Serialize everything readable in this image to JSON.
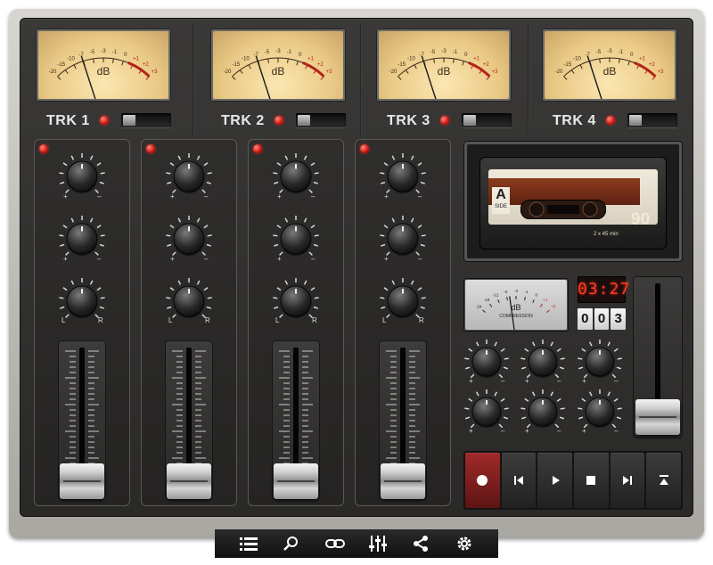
{
  "meters": [
    {
      "track_label": "TRK 1"
    },
    {
      "track_label": "TRK 2"
    },
    {
      "track_label": "TRK 3"
    },
    {
      "track_label": "TRK 4"
    }
  ],
  "meter_scale": {
    "unit": "dB",
    "ticks": [
      "-20",
      "-15",
      "-10",
      "-7",
      "-5",
      "-3",
      "-1",
      "0",
      "+1",
      "+2",
      "+3"
    ]
  },
  "pan_labels": {
    "left": "L",
    "right": "R"
  },
  "cassette": {
    "side": "A",
    "side_word": "SIDE",
    "length": "90",
    "length_detail": "2 x 45 min"
  },
  "compression_meter": {
    "unit": "dB",
    "label": "COMPRESSION",
    "ticks": [
      "-24",
      "-18",
      "-12",
      "-6",
      "-3",
      "-1",
      "0",
      "+1",
      "+3"
    ]
  },
  "timer_display": "03:27",
  "tape_counter": [
    "0",
    "0",
    "3"
  ],
  "transport_buttons": [
    "record-icon",
    "skip-back-icon",
    "play-icon",
    "stop-icon",
    "skip-forward-icon",
    "eject-icon"
  ],
  "toolbar_icons": [
    "list-icon",
    "search-icon",
    "link-icon",
    "equalizer-icon",
    "share-icon",
    "settings-icon"
  ],
  "colors": {
    "led_red": "#d1140c",
    "meter_face": "#f4d99c",
    "record_button": "#a12a2a",
    "lcd_text": "#ff3a22"
  }
}
